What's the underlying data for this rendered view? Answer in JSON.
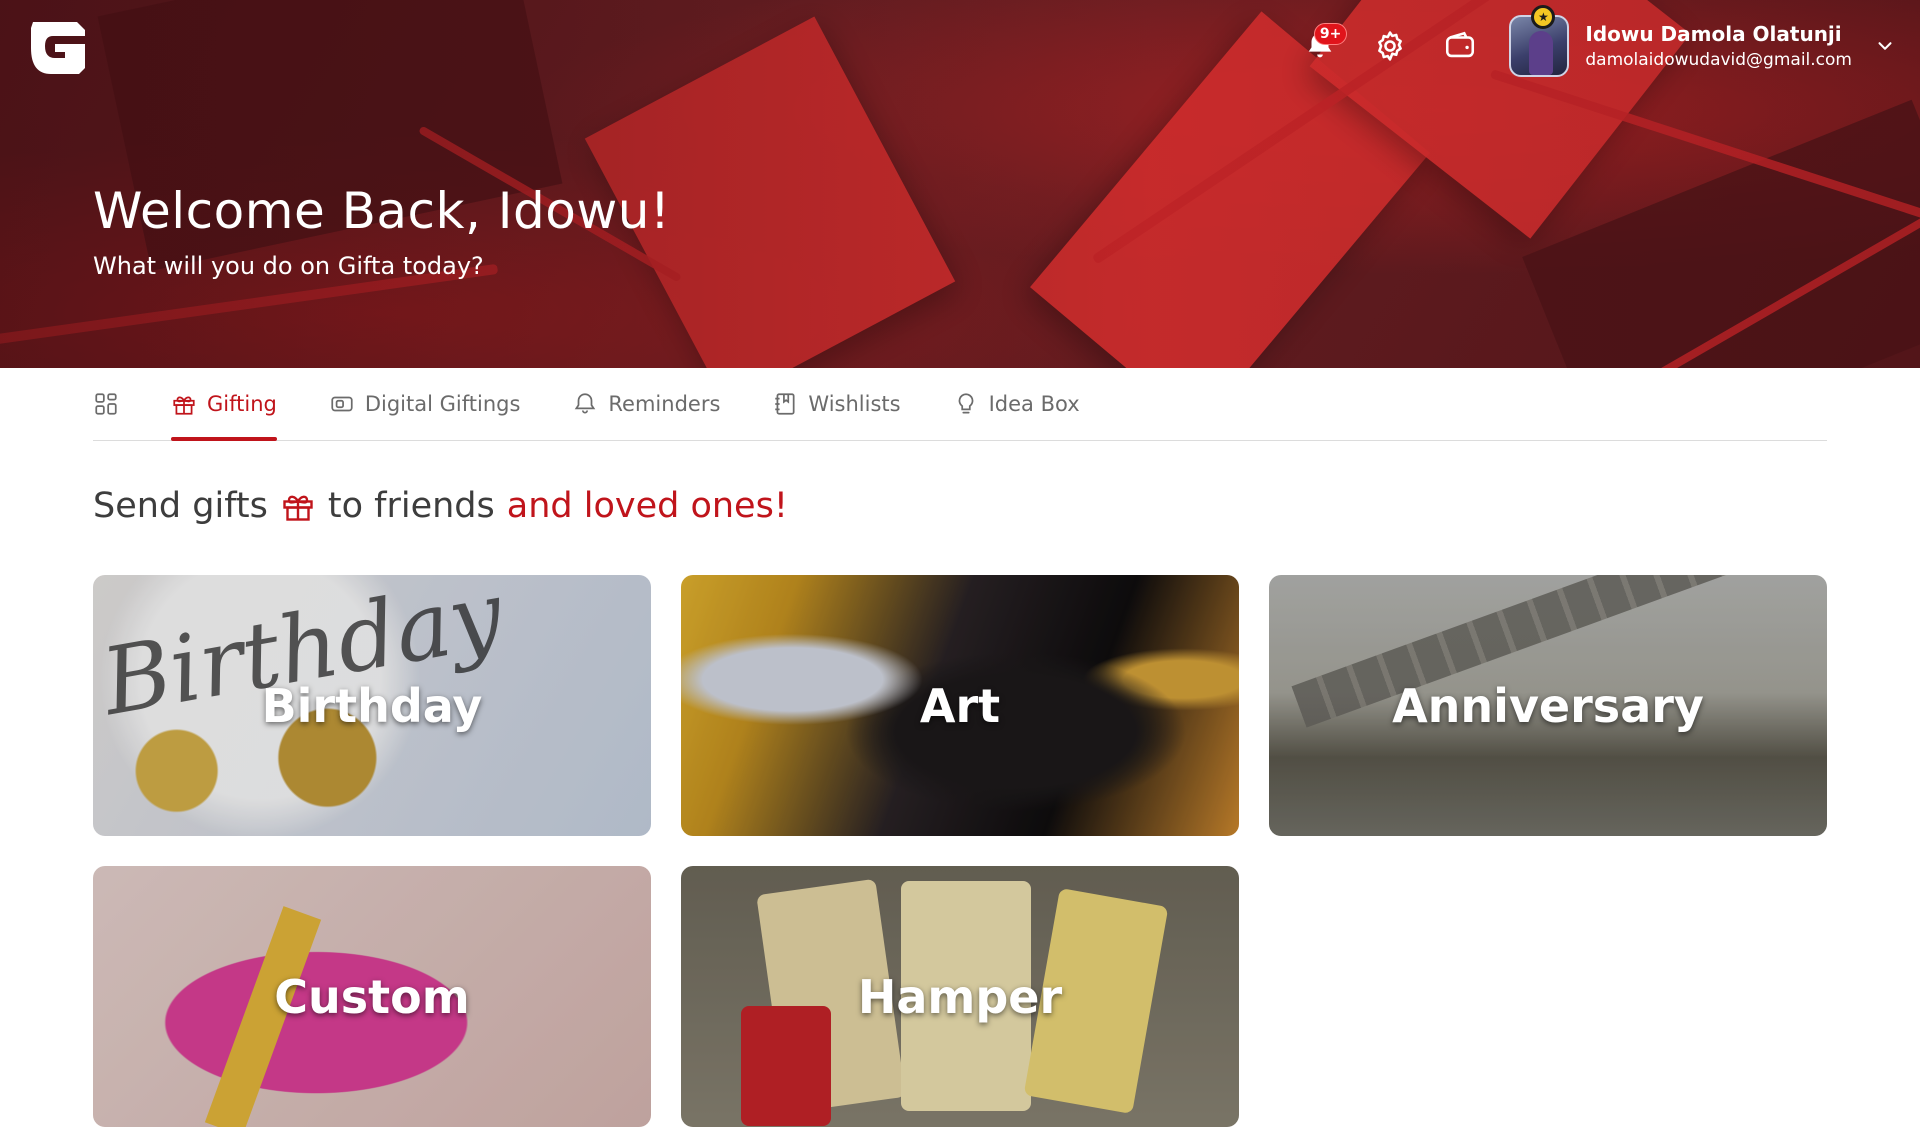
{
  "header": {
    "logo_letter": "G",
    "welcome_title": "Welcome Back, Idowu!",
    "welcome_subtitle": "What will you do on Gifta today?",
    "notifications_badge": "9+",
    "user_name": "Idowu Damola Olatunji",
    "user_email": "damolaidowudavid@gmail.com",
    "icons": [
      "bell-icon",
      "gear-icon",
      "wallet-icon",
      "chevron-down-icon"
    ]
  },
  "tabs": [
    {
      "label": "",
      "icon": "grid-icon",
      "active": false
    },
    {
      "label": "Gifting",
      "icon": "gift-icon",
      "active": true
    },
    {
      "label": "Digital Giftings",
      "icon": "ticket-icon",
      "active": false
    },
    {
      "label": "Reminders",
      "icon": "bell-icon",
      "active": false
    },
    {
      "label": "Wishlists",
      "icon": "notebook-icon",
      "active": false
    },
    {
      "label": "Idea Box",
      "icon": "lightbulb-icon",
      "active": false
    }
  ],
  "section": {
    "heading_part1": "Send gifts",
    "heading_part2": "to friends",
    "heading_accent": "and loved ones!"
  },
  "categories": [
    {
      "label": "Birthday"
    },
    {
      "label": "Art"
    },
    {
      "label": "Anniversary"
    },
    {
      "label": "Custom"
    },
    {
      "label": "Hamper"
    }
  ],
  "colors": {
    "accent": "#c0141b",
    "hero": "#6e2226",
    "tab_inactive": "#6b6b6b"
  }
}
